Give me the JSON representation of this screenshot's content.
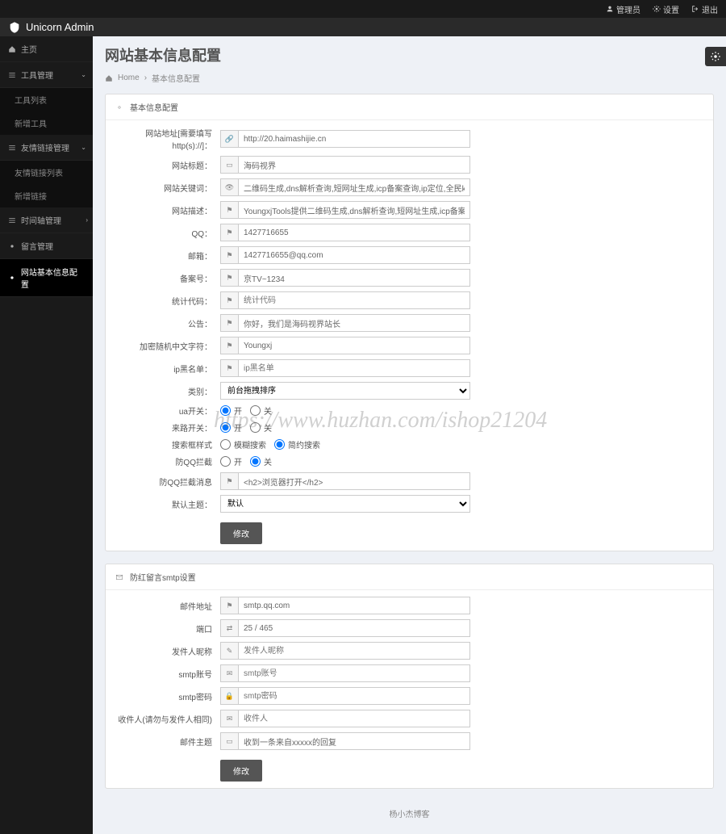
{
  "topbar": {
    "admin": "管理员",
    "settings": "设置",
    "logout": "退出"
  },
  "header": {
    "brand": "Unicorn Admin"
  },
  "sidebar": {
    "home": "主页",
    "tools": "工具管理",
    "tools_list": "工具列表",
    "tools_add": "新增工具",
    "links": "友情链接管理",
    "links_list": "友情链接列表",
    "links_add": "新增链接",
    "timeline": "时间轴管理",
    "msg": "留言管理",
    "siteinfo": "网站基本信息配置"
  },
  "page": {
    "title": "网站基本信息配置",
    "bc_home": "Home",
    "bc_current": "基本信息配置"
  },
  "panel1": {
    "title": "基本信息配置",
    "labels": {
      "url": "网站地址[需要填写http(s)://]：",
      "title": "网站标题：",
      "keywords": "网站关键词：",
      "desc": "网站描述：",
      "qq": "QQ：",
      "email": "邮箱：",
      "beian": "备案号：",
      "tongji": "统计代码：",
      "notice": "公告：",
      "encrypt": "加密随机中文字符：",
      "ipblack": "ip黑名单：",
      "category": "类别：",
      "ua_switch": "ua开关：",
      "referer_switch": "来路开关：",
      "search_style": "搜索框样式",
      "qq_block": "防QQ拦截",
      "qq_block_msg": "防QQ拦截消息",
      "default_theme": "默认主题："
    },
    "values": {
      "url": "http://20.haimashijie.cn",
      "title": "海码视界",
      "keywords": "二维码生成,dns解析查询,短网址生成,icp备案查询,ip定位,全民k歌解析,在线ping,端口扫描,子域",
      "desc": "YoungxjTools提供二维码生成,dns解析查询,短网址生成,icp备案查询,ip定位,全民k歌解析,在线p",
      "qq": "1427716655",
      "email": "1427716655@qq.com",
      "beian": "京TV~1234",
      "tongji_placeholder": "统计代码",
      "notice": "你好，我们是海码视界站长",
      "encrypt": "Youngxj",
      "ipblack_placeholder": "ip黑名单",
      "category": "前台拖拽排序",
      "qq_block_msg": "<h2>浏览器打开</h2>",
      "default_theme": "默认"
    },
    "radios": {
      "on": "开",
      "off": "关",
      "fuzzy": "模糊搜索",
      "simple": "简约搜索"
    },
    "submit": "修改"
  },
  "panel2": {
    "title": "防红留言smtp设置",
    "labels": {
      "mail_addr": "邮件地址",
      "port": "端口",
      "sender_nick": "发件人昵称",
      "smtp_account": "smtp账号",
      "smtp_pwd": "smtp密码",
      "receiver": "收件人(请勿与发件人相同)",
      "mail_subject": "邮件主题"
    },
    "values": {
      "mail_addr": "smtp.qq.com",
      "port": "25 / 465",
      "sender_nick_placeholder": "发件人昵称",
      "smtp_account_placeholder": "smtp账号",
      "smtp_pwd_placeholder": "smtp密码",
      "receiver_placeholder": "收件人",
      "mail_subject": "收到一条来自xxxxx的回复"
    },
    "submit": "修改"
  },
  "watermark": "https://www.huzhan.com/ishop21204",
  "footer": "杨小杰博客"
}
